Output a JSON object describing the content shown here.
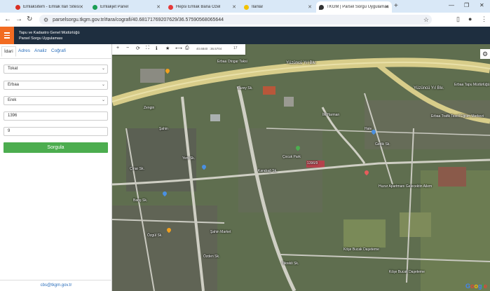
{
  "browser": {
    "tabs": [
      {
        "label": "Emlaksitem - Emlak İlan Sitesi - ",
        "color": "#d93025"
      },
      {
        "label": "Emlakjet Panel",
        "color": "#1a9e54"
      },
      {
        "label": "Hepsi Emlak Bana Özel",
        "color": "#e5393a"
      },
      {
        "label": "İlanlar",
        "color": "#f2c200"
      },
      {
        "label": "TKGM | Parsel Sorgu Uygulaması",
        "color": "#333333"
      }
    ],
    "new_tab": "+",
    "url": "parselsorgu.tkgm.gov.tr/#ara/cografi/40.68171769207629/36.57590568065644"
  },
  "app": {
    "title_line1": "Tapu ve Kadastro Genel Müdürlüğü",
    "title_line2": "Parsel Sorgu Uygulaması",
    "header_color": "#1e2e3f",
    "accent": "#f26b21"
  },
  "panel": {
    "tabs": [
      "İdari",
      "Adres",
      "Analiz",
      "Coğrafi"
    ],
    "province": "Tokat",
    "district": "Erbaa",
    "neighborhood": "Erek",
    "block": "1396",
    "parcel": "9",
    "query_button": "Sorgula",
    "footer_email": "cbs@tkgm.gov.tr",
    "button_color": "#4cad4f"
  },
  "map": {
    "coordinates": "40.6840 : 36.5704",
    "zoom": "17",
    "labels": {
      "road_main": "Yüzüncü Yıl Blv.",
      "road_main2": "Yüzüncü Yıl Blv.",
      "erbaa_otogar": "Erbaa Otogar Taksi",
      "erbaa_tapu": "Erbaa Tapu Müdürlüğü",
      "erbaa_trafik": "Erbaa Trafik Tescil Eğitim Merkezi",
      "zengin": "Zengin",
      "kuzey_sk": "Kuzey Sk.",
      "sahin": "Şahin",
      "ilk_harman": "İlk Harman",
      "hale": "Hale",
      "cocuk_park": "Çocuk Park",
      "karabag": "Karabağ Sk.",
      "huzur_apt": "Huzur Apartmanı Gelecektin Ailem",
      "kose_bucak": "Köşe Bucak Daşeteme",
      "kose_bucak2": "Köşe Bucak Daşeteme",
      "gedik_sk": "Gedik Sk.",
      "tikrekli_sk": "Tikrekli Sk.",
      "yeni_sk": "Yeni Sk.",
      "cinar_sk": "Çınar Sk.",
      "baris_sk": "Barış Sk.",
      "ozden_sk": "Özden Sk.",
      "sahin_market": "Şahin Market",
      "ozgul_sk": "Özgül Sk.",
      "parcel_label": "1396/9"
    },
    "google": "Google"
  }
}
